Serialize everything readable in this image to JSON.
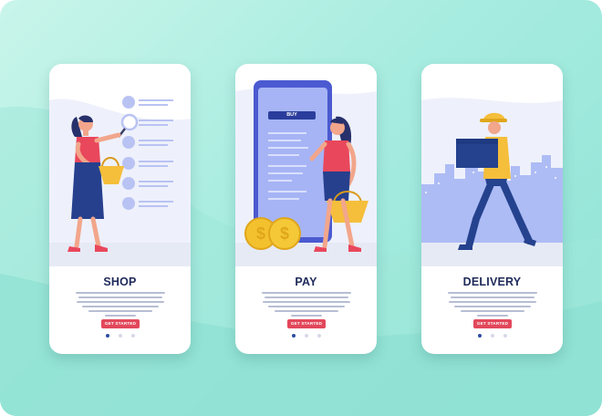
{
  "screens": [
    {
      "title": "SHOP",
      "cta_label": "GET STARTED",
      "active_dot": 0
    },
    {
      "title": "PAY",
      "cta_label": "GET STARTED",
      "active_dot": 0,
      "phone_button_label": "BUY"
    },
    {
      "title": "DELIVERY",
      "cta_label": "GET STARTED",
      "active_dot": 0
    }
  ],
  "colors": {
    "accent": "#e2485b",
    "title": "#1f2a5a",
    "phone": "#5f6fe0",
    "coin": "#f3c12d",
    "box": "#25428e",
    "background": "#a8ece0"
  },
  "icons": [
    "magnifier-icon",
    "coin-icon",
    "basket-icon",
    "box-icon"
  ]
}
